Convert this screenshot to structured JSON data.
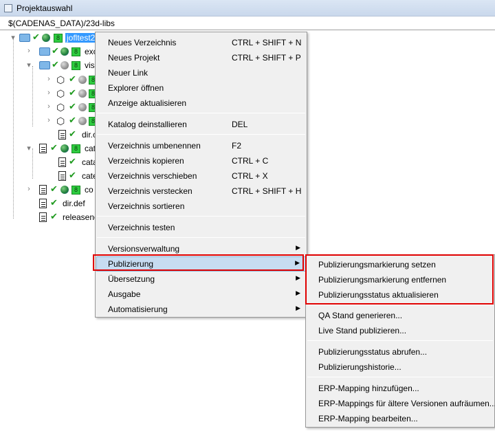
{
  "window": {
    "title": "Projektauswahl"
  },
  "path": {
    "text": "$(CADENAS_DATA)/23d-libs"
  },
  "tree": {
    "root": "jofltest2",
    "n1": "exc",
    "n2": "vis",
    "n7": "dir.c",
    "n8": "cata",
    "n9": "cata",
    "n10": "cate",
    "n11": "co",
    "n12": "dir.def",
    "n13": "releasenc",
    "badge": "8"
  },
  "context_menu": {
    "items": [
      {
        "label": "Neues Verzeichnis",
        "shortcut": "CTRL + SHIFT + N"
      },
      {
        "label": "Neues Projekt",
        "shortcut": "CTRL + SHIFT + P"
      },
      {
        "label": "Neuer Link",
        "shortcut": ""
      },
      {
        "label": "Explorer öffnen",
        "shortcut": ""
      },
      {
        "label": "Anzeige aktualisieren",
        "shortcut": ""
      },
      {
        "label": "Katalog deinstallieren",
        "shortcut": "DEL"
      },
      {
        "label": "Verzeichnis umbenennen",
        "shortcut": "F2"
      },
      {
        "label": "Verzeichnis kopieren",
        "shortcut": "CTRL + C"
      },
      {
        "label": "Verzeichnis verschieben",
        "shortcut": "CTRL + X"
      },
      {
        "label": "Verzeichnis verstecken",
        "shortcut": "CTRL + SHIFT + H"
      },
      {
        "label": "Verzeichnis sortieren",
        "shortcut": ""
      },
      {
        "label": "Verzeichnis testen",
        "shortcut": ""
      },
      {
        "label": "Versionsverwaltung",
        "shortcut": ""
      },
      {
        "label": "Publizierung",
        "shortcut": ""
      },
      {
        "label": "Übersetzung",
        "shortcut": ""
      },
      {
        "label": "Ausgabe",
        "shortcut": ""
      },
      {
        "label": "Automatisierung",
        "shortcut": ""
      }
    ]
  },
  "submenu": {
    "items": [
      {
        "label": "Publizierungsmarkierung setzen"
      },
      {
        "label": "Publizierungsmarkierung entfernen"
      },
      {
        "label": "Publizierungsstatus aktualisieren"
      },
      {
        "label": "QA Stand generieren..."
      },
      {
        "label": "Live Stand publizieren..."
      },
      {
        "label": "Publizierungsstatus abrufen..."
      },
      {
        "label": "Publizierungshistorie..."
      },
      {
        "label": "ERP-Mapping hinzufügen..."
      },
      {
        "label": "ERP-Mappings für ältere Versionen aufräumen..."
      },
      {
        "label": "ERP-Mapping bearbeiten..."
      }
    ]
  },
  "colors": {
    "highlight_box": "#e00000",
    "selection": "#3399ff",
    "menu_bg": "#f0f0f0"
  }
}
